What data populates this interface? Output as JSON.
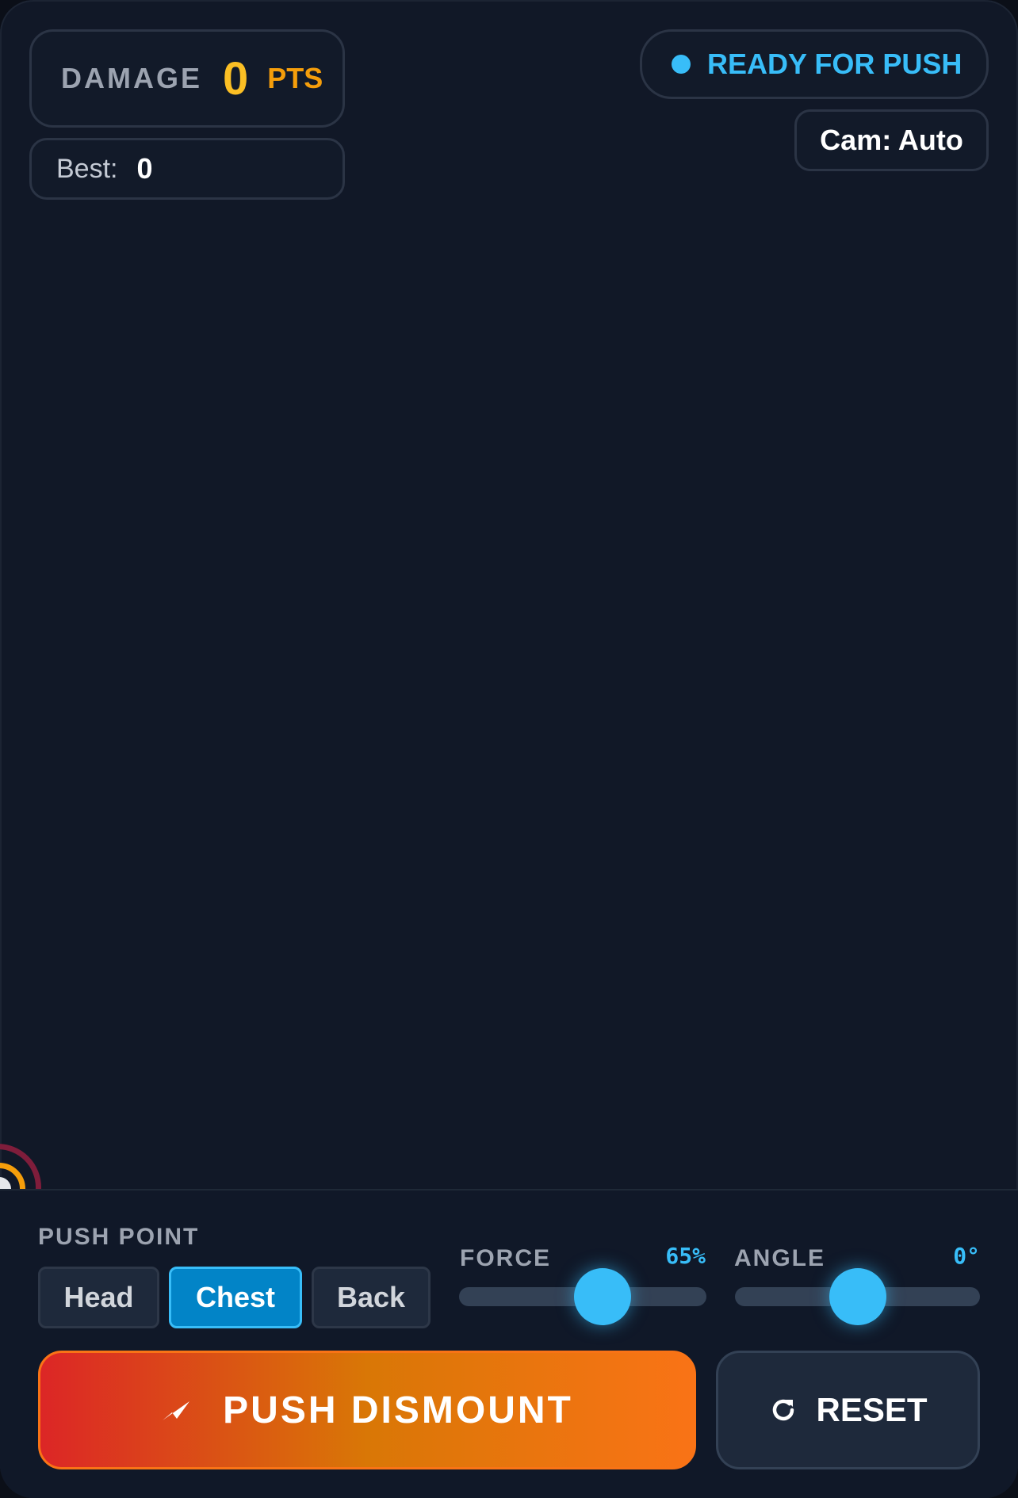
{
  "hud": {
    "damage_label": "DAMAGE",
    "damage_value": "0",
    "damage_unit": "PTS",
    "best_label": "Best:",
    "best_value": "0",
    "status_text": "READY FOR PUSH",
    "cam_label": "Cam: Auto"
  },
  "controls": {
    "push_point_label": "PUSH POINT",
    "push_points": [
      "Head",
      "Chest",
      "Back"
    ],
    "selected_push_point": "Chest",
    "force_label": "FORCE",
    "force_value": "65%",
    "force_level": 0.58,
    "angle_label": "ANGLE",
    "angle_value": "0°",
    "angle_level": 0.5,
    "push_button_label": "PUSH DISMOUNT",
    "reset_button_label": "RESET"
  },
  "colors": {
    "accent": "#38bdf8",
    "damage": "#fbbf24",
    "push_gradient": [
      "#dc2626",
      "#f97316"
    ]
  },
  "icons": {
    "status": "status-dot-icon",
    "push": "send-icon",
    "reset": "refresh-icon"
  }
}
